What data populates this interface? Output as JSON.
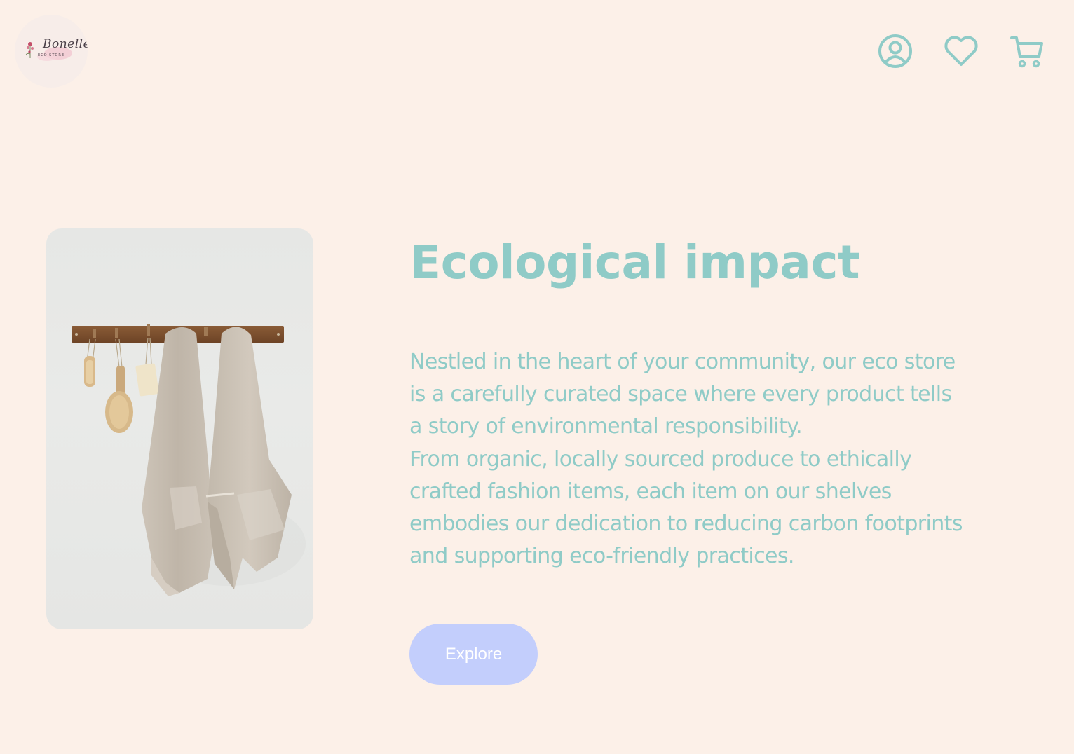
{
  "header": {
    "logo": {
      "script_text": "Bonelle",
      "subtitle": "ECO STORE"
    },
    "icons": [
      {
        "name": "account-icon"
      },
      {
        "name": "heart-icon"
      },
      {
        "name": "cart-icon"
      }
    ]
  },
  "hero": {
    "image": "towels-on-wooden-hook-rack",
    "title": "Ecological impact",
    "description_lines": [
      "Nestled in the heart of your community, our eco store",
      "is a carefully curated space where every product tells",
      "a story of environmental responsibility.",
      "From organic, locally sourced produce to ethically",
      "crafted fashion items, each item on our shelves",
      "embodies our dedication to reducing carbon footprints",
      "and supporting eco-friendly practices."
    ],
    "button_label": "Explore"
  },
  "colors": {
    "background": "#fcf0e8",
    "accent_teal": "#8fcbc7",
    "button": "#c3cefc"
  }
}
